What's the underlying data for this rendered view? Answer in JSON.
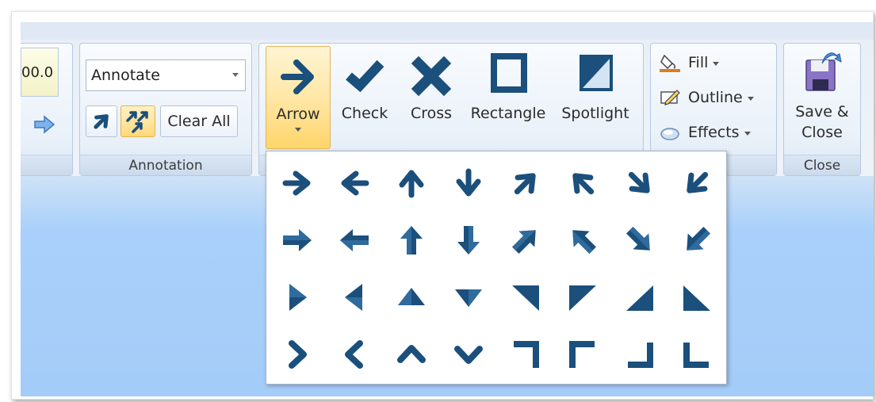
{
  "zoom": {
    "value": "00.0"
  },
  "annotation": {
    "combo_value": "Annotate",
    "clear_all_label": "Clear All",
    "group_label": "Annotation"
  },
  "shapes": {
    "buttons": [
      {
        "label": "Arrow",
        "icon": "arrow-icon",
        "active": true
      },
      {
        "label": "Check",
        "icon": "check-icon"
      },
      {
        "label": "Cross",
        "icon": "cross-icon"
      },
      {
        "label": "Rectangle",
        "icon": "rectangle-icon"
      },
      {
        "label": "Spotlight",
        "icon": "spotlight-icon"
      }
    ]
  },
  "format": {
    "fill_label": "Fill",
    "outline_label": "Outline",
    "effects_label": "Effects",
    "group_label_partial": "e"
  },
  "close": {
    "save_line1": "Save &",
    "save_line2": "Close",
    "group_label": "Close"
  },
  "gallery": {
    "rows": [
      [
        "arrow-right",
        "arrow-left",
        "arrow-up",
        "arrow-down",
        "arrow-up-right",
        "arrow-up-left",
        "arrow-down-right",
        "arrow-down-left"
      ],
      [
        "block-arrow-right",
        "block-arrow-left",
        "block-arrow-up",
        "block-arrow-down",
        "block-arrow-up-right",
        "block-arrow-up-left",
        "block-arrow-down-right",
        "block-arrow-down-left"
      ],
      [
        "triangle-right",
        "triangle-left",
        "triangle-up",
        "triangle-down",
        "corner-triangle-top-right",
        "corner-triangle-top-left",
        "corner-triangle-bottom-right",
        "corner-triangle-bottom-left"
      ],
      [
        "chevron-right",
        "chevron-left",
        "chevron-up",
        "chevron-down",
        "corner-top-right",
        "corner-top-left",
        "corner-bottom-right",
        "corner-bottom-left"
      ]
    ]
  },
  "colors": {
    "icon_blue": "#1b4f7c",
    "accent_orange": "#ffd56b"
  }
}
